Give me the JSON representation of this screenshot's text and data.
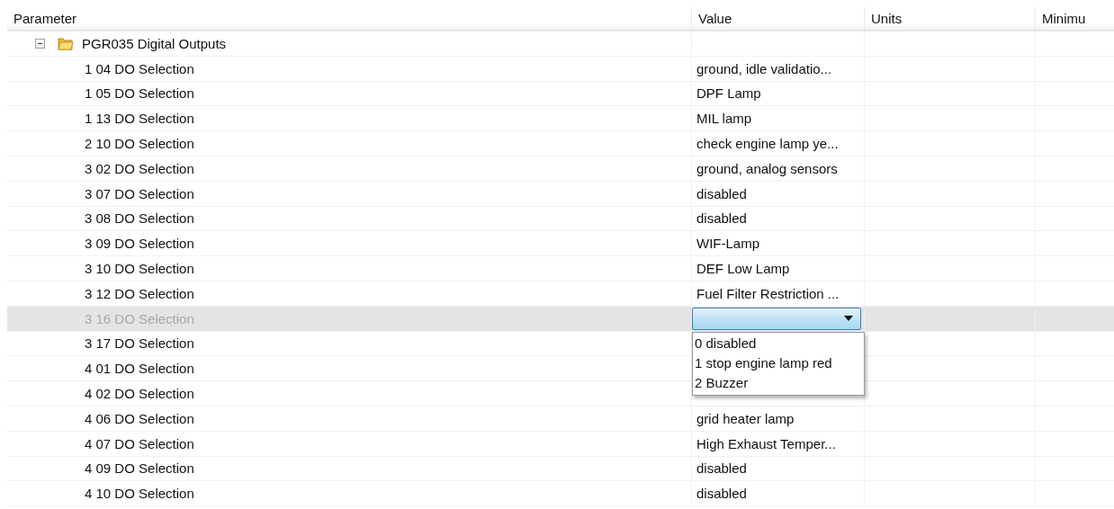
{
  "table": {
    "columns": [
      "Parameter",
      "Value",
      "Units",
      "Minimu"
    ],
    "group": {
      "label": "PGR035 Digital Outputs",
      "expanded": true,
      "rows": [
        {
          "parameter": "1 04 DO Selection",
          "value": "ground, idle validatio...",
          "selected": false
        },
        {
          "parameter": "1 05 DO Selection",
          "value": "DPF Lamp",
          "selected": false
        },
        {
          "parameter": "1 13 DO Selection",
          "value": "MIL lamp",
          "selected": false
        },
        {
          "parameter": "2 10 DO Selection",
          "value": "check engine lamp ye...",
          "selected": false
        },
        {
          "parameter": "3 02 DO Selection",
          "value": "ground, analog sensors",
          "selected": false
        },
        {
          "parameter": "3 07 DO Selection",
          "value": "disabled",
          "selected": false
        },
        {
          "parameter": "3 08 DO Selection",
          "value": "disabled",
          "selected": false
        },
        {
          "parameter": "3 09 DO Selection",
          "value": "WIF-Lamp",
          "selected": false
        },
        {
          "parameter": "3 10 DO Selection",
          "value": "DEF Low Lamp",
          "selected": false
        },
        {
          "parameter": "3 12 DO Selection",
          "value": "Fuel Filter Restriction ...",
          "selected": false
        },
        {
          "parameter": "3 16 DO Selection",
          "selected": true,
          "dropdown": {
            "options": [
              "0 disabled",
              "1 stop engine lamp red",
              "2 Buzzer"
            ]
          }
        },
        {
          "parameter": "3 17 DO Selection",
          "selected": false
        },
        {
          "parameter": "4 01 DO Selection",
          "selected": false
        },
        {
          "parameter": "4 02 DO Selection",
          "selected": false
        },
        {
          "parameter": "4 06 DO Selection",
          "value": "grid heater lamp",
          "selected": false
        },
        {
          "parameter": "4 07 DO Selection",
          "value": "High Exhaust Temper...",
          "selected": false
        },
        {
          "parameter": "4 09 DO Selection",
          "value": "disabled",
          "selected": false
        },
        {
          "parameter": "4 10 DO Selection",
          "value": "disabled",
          "selected": false
        }
      ]
    }
  }
}
